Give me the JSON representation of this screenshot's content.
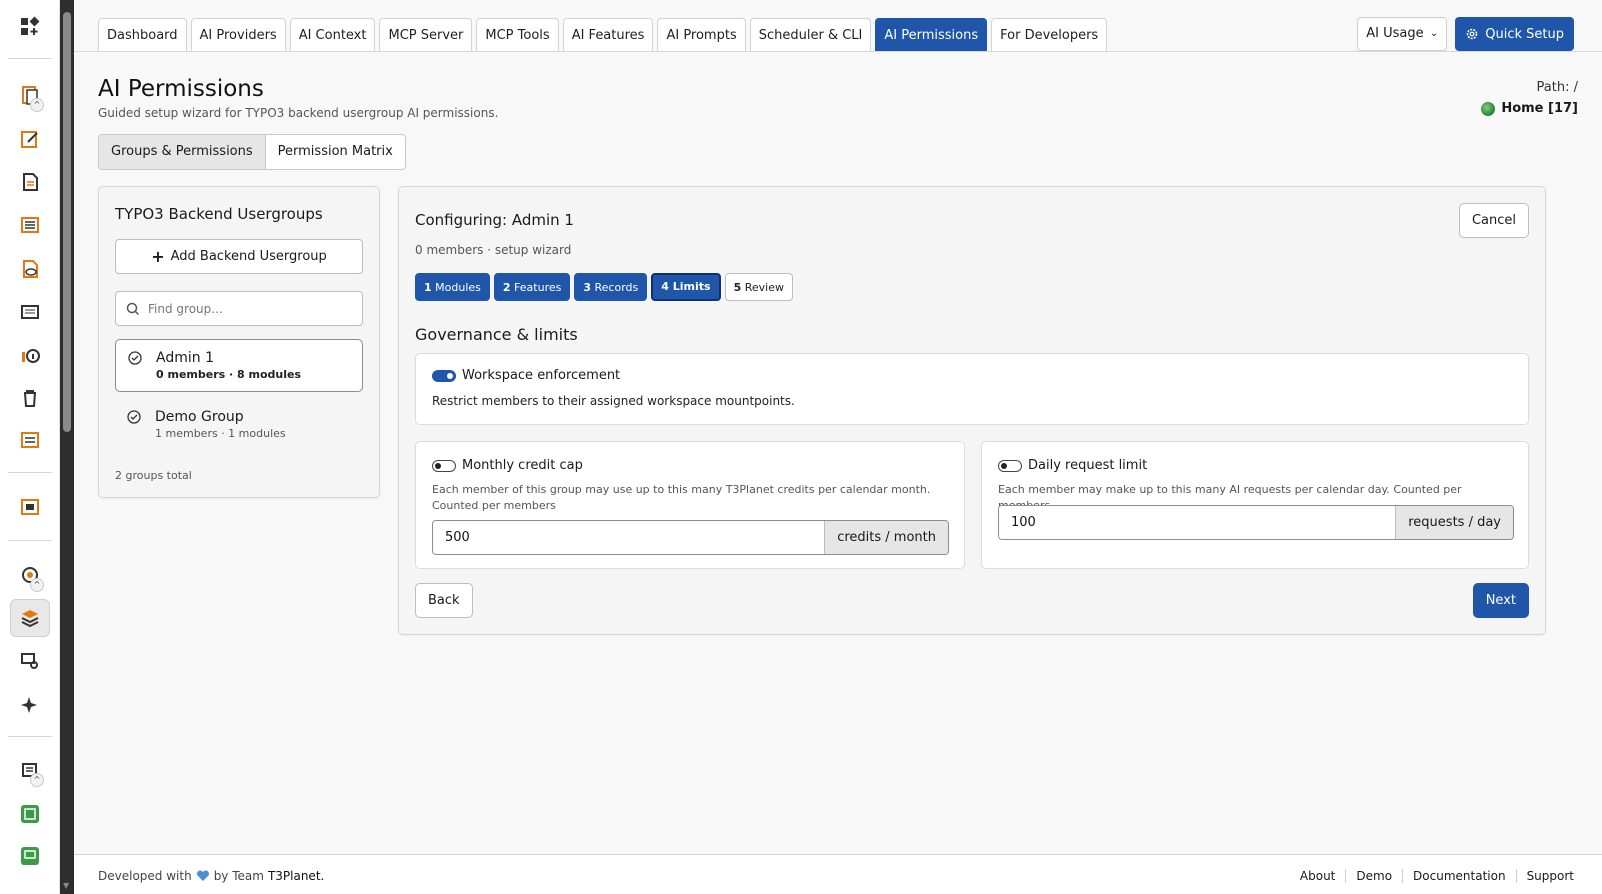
{
  "tabs": [
    "Dashboard",
    "AI Providers",
    "AI Context",
    "MCP Server",
    "MCP Tools",
    "AI Features",
    "AI Prompts",
    "Scheduler & CLI",
    "AI Permissions",
    "For Developers"
  ],
  "active_tab": "AI Permissions",
  "usage_select": "AI Usage",
  "quick_setup": "Quick Setup",
  "page": {
    "title": "AI Permissions",
    "subtitle": "Guided setup wizard for TYPO3 backend usergroup AI permissions.",
    "path_label": "Path: /",
    "home_label": "Home [17]"
  },
  "segment_tabs": [
    "Groups & Permissions",
    "Permission Matrix"
  ],
  "groups_panel": {
    "title": "TYPO3 Backend Usergroups",
    "add_label": "Add Backend Usergroup",
    "find_placeholder": "Find group...",
    "groups": [
      {
        "name": "Admin 1",
        "meta": "0 members · 8 modules"
      },
      {
        "name": "Demo Group",
        "meta": "1 members · 1 modules"
      }
    ],
    "total": "2 groups total"
  },
  "wizard": {
    "title": "Configuring: Admin 1",
    "cancel": "Cancel",
    "meta": "0 members · setup wizard",
    "steps": [
      {
        "num": "1",
        "label": "Modules"
      },
      {
        "num": "2",
        "label": "Features"
      },
      {
        "num": "3",
        "label": "Records"
      },
      {
        "num": "4",
        "label": "Limits"
      },
      {
        "num": "5",
        "label": "Review"
      }
    ],
    "section_title": "Governance & limits",
    "workspace": {
      "label": "Workspace enforcement",
      "desc": "Restrict members to their assigned workspace mountpoints."
    },
    "credit_cap": {
      "label": "Monthly credit cap",
      "desc": "Each member of this group may use up to this many T3Planet credits per calendar month. Counted per members",
      "value": "500",
      "unit": "credits / month"
    },
    "request_limit": {
      "label": "Daily request limit",
      "desc": "Each member may make up to this many AI requests per calendar day. Counted per members.",
      "value": "100",
      "unit": "requests / day"
    },
    "back": "Back",
    "next": "Next"
  },
  "footer": {
    "prefix": "Developed with",
    "by": "by Team",
    "brand": "T3Planet.",
    "links": [
      "About",
      "Demo",
      "Documentation",
      "Support"
    ]
  }
}
